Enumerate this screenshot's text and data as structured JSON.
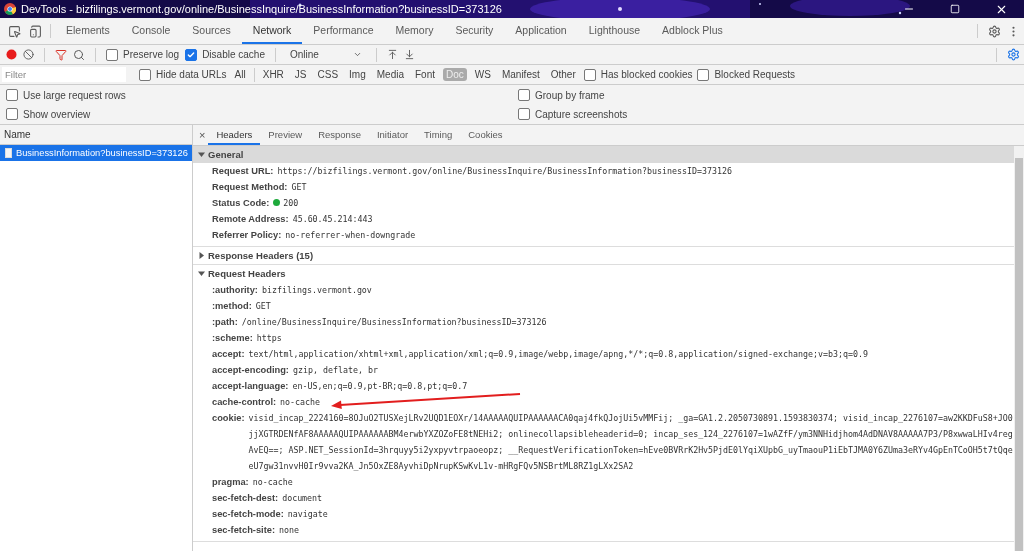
{
  "window": {
    "title": "DevTools - bizfilings.vermont.gov/online/BusinessInquire/BusinessInformation?businessID=373126"
  },
  "panel_tabs": [
    {
      "label": "Elements",
      "selected": false
    },
    {
      "label": "Console",
      "selected": false
    },
    {
      "label": "Sources",
      "selected": false
    },
    {
      "label": "Network",
      "selected": true
    },
    {
      "label": "Performance",
      "selected": false
    },
    {
      "label": "Memory",
      "selected": false
    },
    {
      "label": "Security",
      "selected": false
    },
    {
      "label": "Application",
      "selected": false
    },
    {
      "label": "Lighthouse",
      "selected": false
    },
    {
      "label": "Adblock Plus",
      "selected": false
    }
  ],
  "toolbar": {
    "checkboxes": [
      {
        "label": "Preserve log",
        "checked": false
      },
      {
        "label": "Disable cache",
        "checked": true
      }
    ],
    "throttling": "Online"
  },
  "filter": {
    "placeholder": "Filter",
    "hide_data_urls": {
      "label": "Hide data URLs",
      "checked": false
    },
    "types": [
      {
        "label": "All",
        "selected": false
      },
      {
        "label": "XHR",
        "selected": false
      },
      {
        "label": "JS",
        "selected": false
      },
      {
        "label": "CSS",
        "selected": false
      },
      {
        "label": "Img",
        "selected": false
      },
      {
        "label": "Media",
        "selected": false
      },
      {
        "label": "Font",
        "selected": false
      },
      {
        "label": "Doc",
        "selected": true
      },
      {
        "label": "WS",
        "selected": false
      },
      {
        "label": "Manifest",
        "selected": false
      },
      {
        "label": "Other",
        "selected": false
      }
    ],
    "extra": [
      {
        "label": "Has blocked cookies",
        "checked": false
      },
      {
        "label": "Blocked Requests",
        "checked": false
      }
    ]
  },
  "options": [
    {
      "label": "Use large request rows",
      "checked": false
    },
    {
      "label": "Group by frame",
      "checked": false
    },
    {
      "label": "Show overview",
      "checked": false
    },
    {
      "label": "Capture screenshots",
      "checked": false
    }
  ],
  "requests": {
    "column": "Name",
    "items": [
      {
        "name": "BusinessInformation?businessID=373126",
        "selected": true
      }
    ]
  },
  "detail": {
    "close": "×",
    "tabs": [
      {
        "label": "Headers",
        "selected": true
      },
      {
        "label": "Preview",
        "selected": false
      },
      {
        "label": "Response",
        "selected": false
      },
      {
        "label": "Initiator",
        "selected": false
      },
      {
        "label": "Timing",
        "selected": false
      },
      {
        "label": "Cookies",
        "selected": false
      }
    ],
    "sections": [
      {
        "title": "General",
        "expanded": true,
        "rows": [
          {
            "key": "Request URL:",
            "value": "https://bizfilings.vermont.gov/online/BusinessInquire/BusinessInformation?businessID=373126"
          },
          {
            "key": "Request Method:",
            "value": "GET"
          },
          {
            "key": "Status Code:",
            "value": "200",
            "color": "#1eaa3c"
          },
          {
            "key": "Remote Address:",
            "value": "45.60.45.214:443"
          },
          {
            "key": "Referrer Policy:",
            "value": "no-referrer-when-downgrade"
          }
        ]
      },
      {
        "title": "Response Headers (15)",
        "expanded": false
      },
      {
        "title": "Request Headers",
        "expanded": true,
        "rows": [
          {
            "key": ":authority:",
            "value": "bizfilings.vermont.gov"
          },
          {
            "key": ":method:",
            "value": "GET"
          },
          {
            "key": ":path:",
            "value": "/online/BusinessInquire/BusinessInformation?businessID=373126"
          },
          {
            "key": ":scheme:",
            "value": "https"
          },
          {
            "key": "accept:",
            "value": "text/html,application/xhtml+xml,application/xml;q=0.9,image/webp,image/apng,*/*;q=0.8,application/signed-exchange;v=b3;q=0.9"
          },
          {
            "key": "accept-encoding:",
            "value": "gzip, deflate, br"
          },
          {
            "key": "accept-language:",
            "value": "en-US,en;q=0.9,pt-BR;q=0.8,pt;q=0.7"
          },
          {
            "key": "cache-control:",
            "value": "no-cache"
          },
          {
            "key": "cookie:",
            "value": "visid_incap_2224160=8OJuO2TUSXejLRv2UQD1EOXr/14AAAAAQUIPAAAAAACA0qaj4fkQJojUi5vMMFij; _ga=GA1.2.2050730891.1593830374; visid_incap_2276107=aw2KKDFuS8+JO0jjXGTRDENfAF8AAAAAQUIPAAAAAABM4erwbYXZOZoFE8tNEHi2; onlinecollapsibleheaderid=0; incap_ses_124_2276107=1wAZfF/ym3NNHidjhom4AdDNAV8AAAAA7P3/P8xwwaLHIv4regAvEQ==; ASP.NET_SessionId=3hrquyy5i2yxpyvtrpaoeopz; __RequestVerificationToken=hEve0BVRrK2Hv5PjdE0lYqiXUpbG_uyTmaouP1iEbTJMA0Y6ZUma3eRYv4GpEnTCoOH5t7tQqeeU7gw31nvvH0Ir9vva2KA_Jn5OxZE8AyvhiDpNrupKSwKvL1v-mHRgFQv5NSBrtML8RZ1gLXx2SA2"
          },
          {
            "key": "pragma:",
            "value": "no-cache"
          },
          {
            "key": "sec-fetch-dest:",
            "value": "document"
          },
          {
            "key": "sec-fetch-mode:",
            "value": "navigate"
          },
          {
            "key": "sec-fetch-site:",
            "value": "none"
          }
        ]
      }
    ]
  }
}
